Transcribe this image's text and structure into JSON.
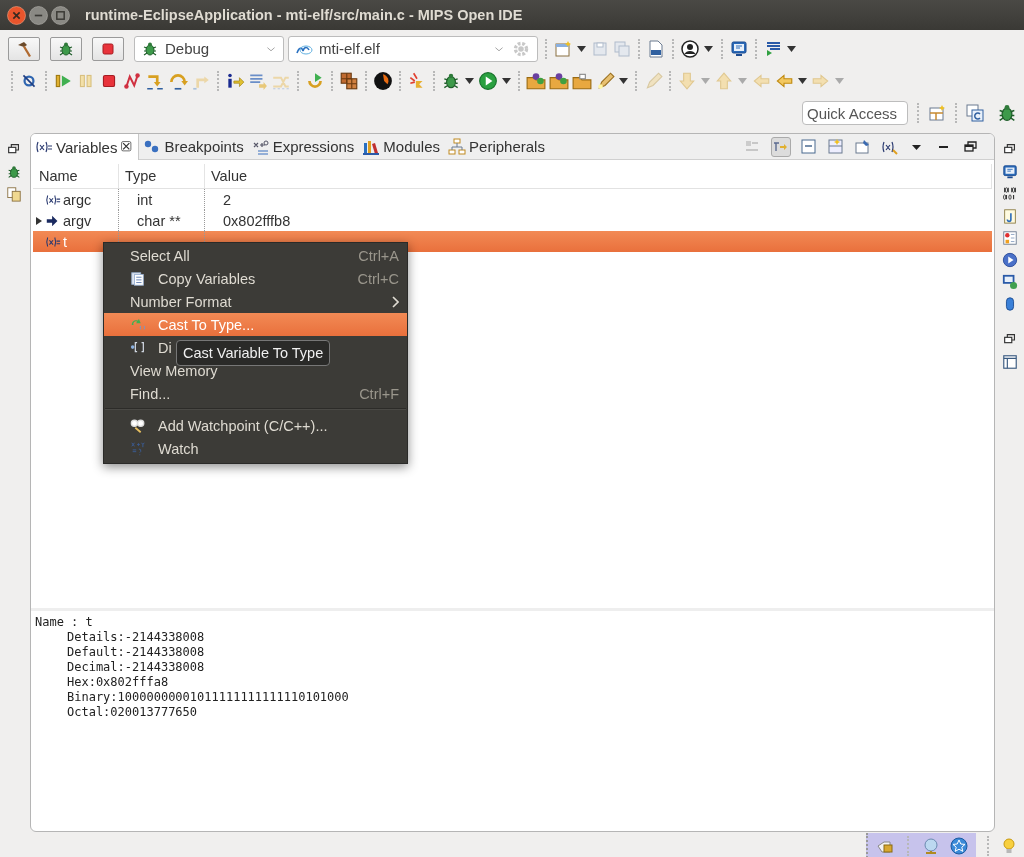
{
  "window": {
    "title": "runtime-EclipseApplication - mti-elf/src/main.c - MIPS Open IDE"
  },
  "launch_bar": {
    "mode": "Debug",
    "target": "mti-elf.elf"
  },
  "quick_access": {
    "placeholder": "Quick Access"
  },
  "view": {
    "tabs": [
      {
        "label": "Variables",
        "selected": true
      },
      {
        "label": "Breakpoints",
        "selected": false
      },
      {
        "label": "Expressions",
        "selected": false
      },
      {
        "label": "Modules",
        "selected": false
      },
      {
        "label": "Peripherals",
        "selected": false
      }
    ],
    "columns": [
      "Name",
      "Type",
      "Value"
    ],
    "rows": [
      {
        "name": "argc",
        "type": "int",
        "value": "2",
        "kind": "variable",
        "expandable": false,
        "selected": false
      },
      {
        "name": "argv",
        "type": "char **",
        "value": "0x802fffb8",
        "kind": "pointer",
        "expandable": true,
        "selected": false
      },
      {
        "name": "t",
        "kind": "variable",
        "expandable": false,
        "selected": true
      }
    ],
    "details": [
      "Name : t",
      "Details:-2144338008",
      "Default:-2144338008",
      "Decimal:-2144338008",
      "Hex:0x802fffa8",
      "Binary:10000000001011111111111110101000",
      "Octal:020013777650"
    ]
  },
  "context_menu": {
    "items": [
      {
        "kind": "item",
        "label": "Select All",
        "shortcut": "Ctrl+A",
        "submenu": false,
        "selected": false
      },
      {
        "kind": "item",
        "label": "Copy Variables",
        "shortcut": "Ctrl+C",
        "submenu": false,
        "selected": false
      },
      {
        "kind": "item",
        "label": "Number Format",
        "submenu": true,
        "selected": false
      },
      {
        "kind": "item",
        "label": "Cast To Type...",
        "submenu": false,
        "selected": true
      },
      {
        "kind": "item",
        "label": "Di",
        "submenu": false,
        "selected": false
      },
      {
        "kind": "item",
        "label": "View Memory",
        "submenu": false,
        "selected": false
      },
      {
        "kind": "item",
        "label": "Find...",
        "shortcut": "Ctrl+F",
        "submenu": false,
        "selected": false
      },
      {
        "kind": "separator"
      },
      {
        "kind": "item",
        "label": "Add Watchpoint (C/C++)...",
        "submenu": false,
        "selected": false
      },
      {
        "kind": "item",
        "label": "Watch",
        "submenu": false,
        "selected": false
      }
    ]
  },
  "tooltip": {
    "text": "Cast Variable To Type"
  }
}
